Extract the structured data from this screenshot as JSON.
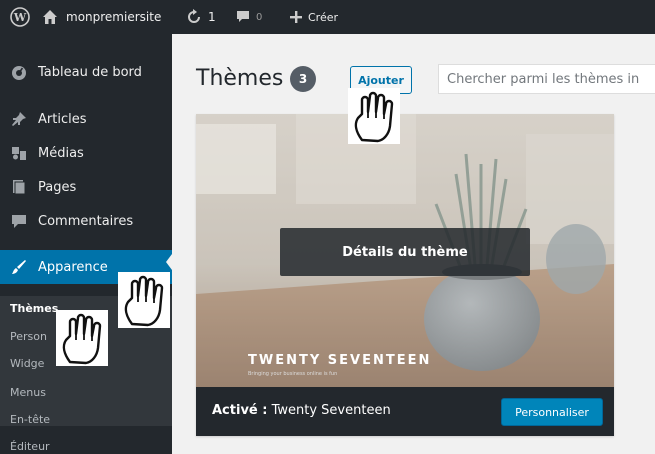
{
  "adminbar": {
    "site_name": "monpremiersite",
    "updates_count": "1",
    "comments_count": "0",
    "new_label": "Créer"
  },
  "sidebar": {
    "items": [
      {
        "label": "Tableau de bord",
        "icon": "dashboard-icon"
      },
      {
        "label": "Articles",
        "icon": "pin-icon"
      },
      {
        "label": "Médias",
        "icon": "media-icon"
      },
      {
        "label": "Pages",
        "icon": "pages-icon"
      },
      {
        "label": "Commentaires",
        "icon": "comment-icon"
      },
      {
        "label": "Apparence",
        "icon": "appearance-brush-icon"
      }
    ],
    "submenu": [
      "Thèmes",
      "Person",
      "Widge",
      "Menus",
      "En-tête",
      "Éditeur"
    ]
  },
  "main": {
    "title": "Thèmes",
    "count": "3",
    "add_label": "Ajouter",
    "search_placeholder": "Chercher parmi les thèmes in"
  },
  "theme_card": {
    "details_label": "Détails du thème",
    "brand": "TWENTY SEVENTEEN",
    "brand_tagline": "Bringing your business online is fun",
    "active_prefix": "Activé :",
    "active_name": "Twenty Seventeen",
    "customize_label": "Personnaliser"
  },
  "colors": {
    "adminbar": "#23282d",
    "accent": "#0073aa",
    "button_primary": "#0085ba"
  }
}
